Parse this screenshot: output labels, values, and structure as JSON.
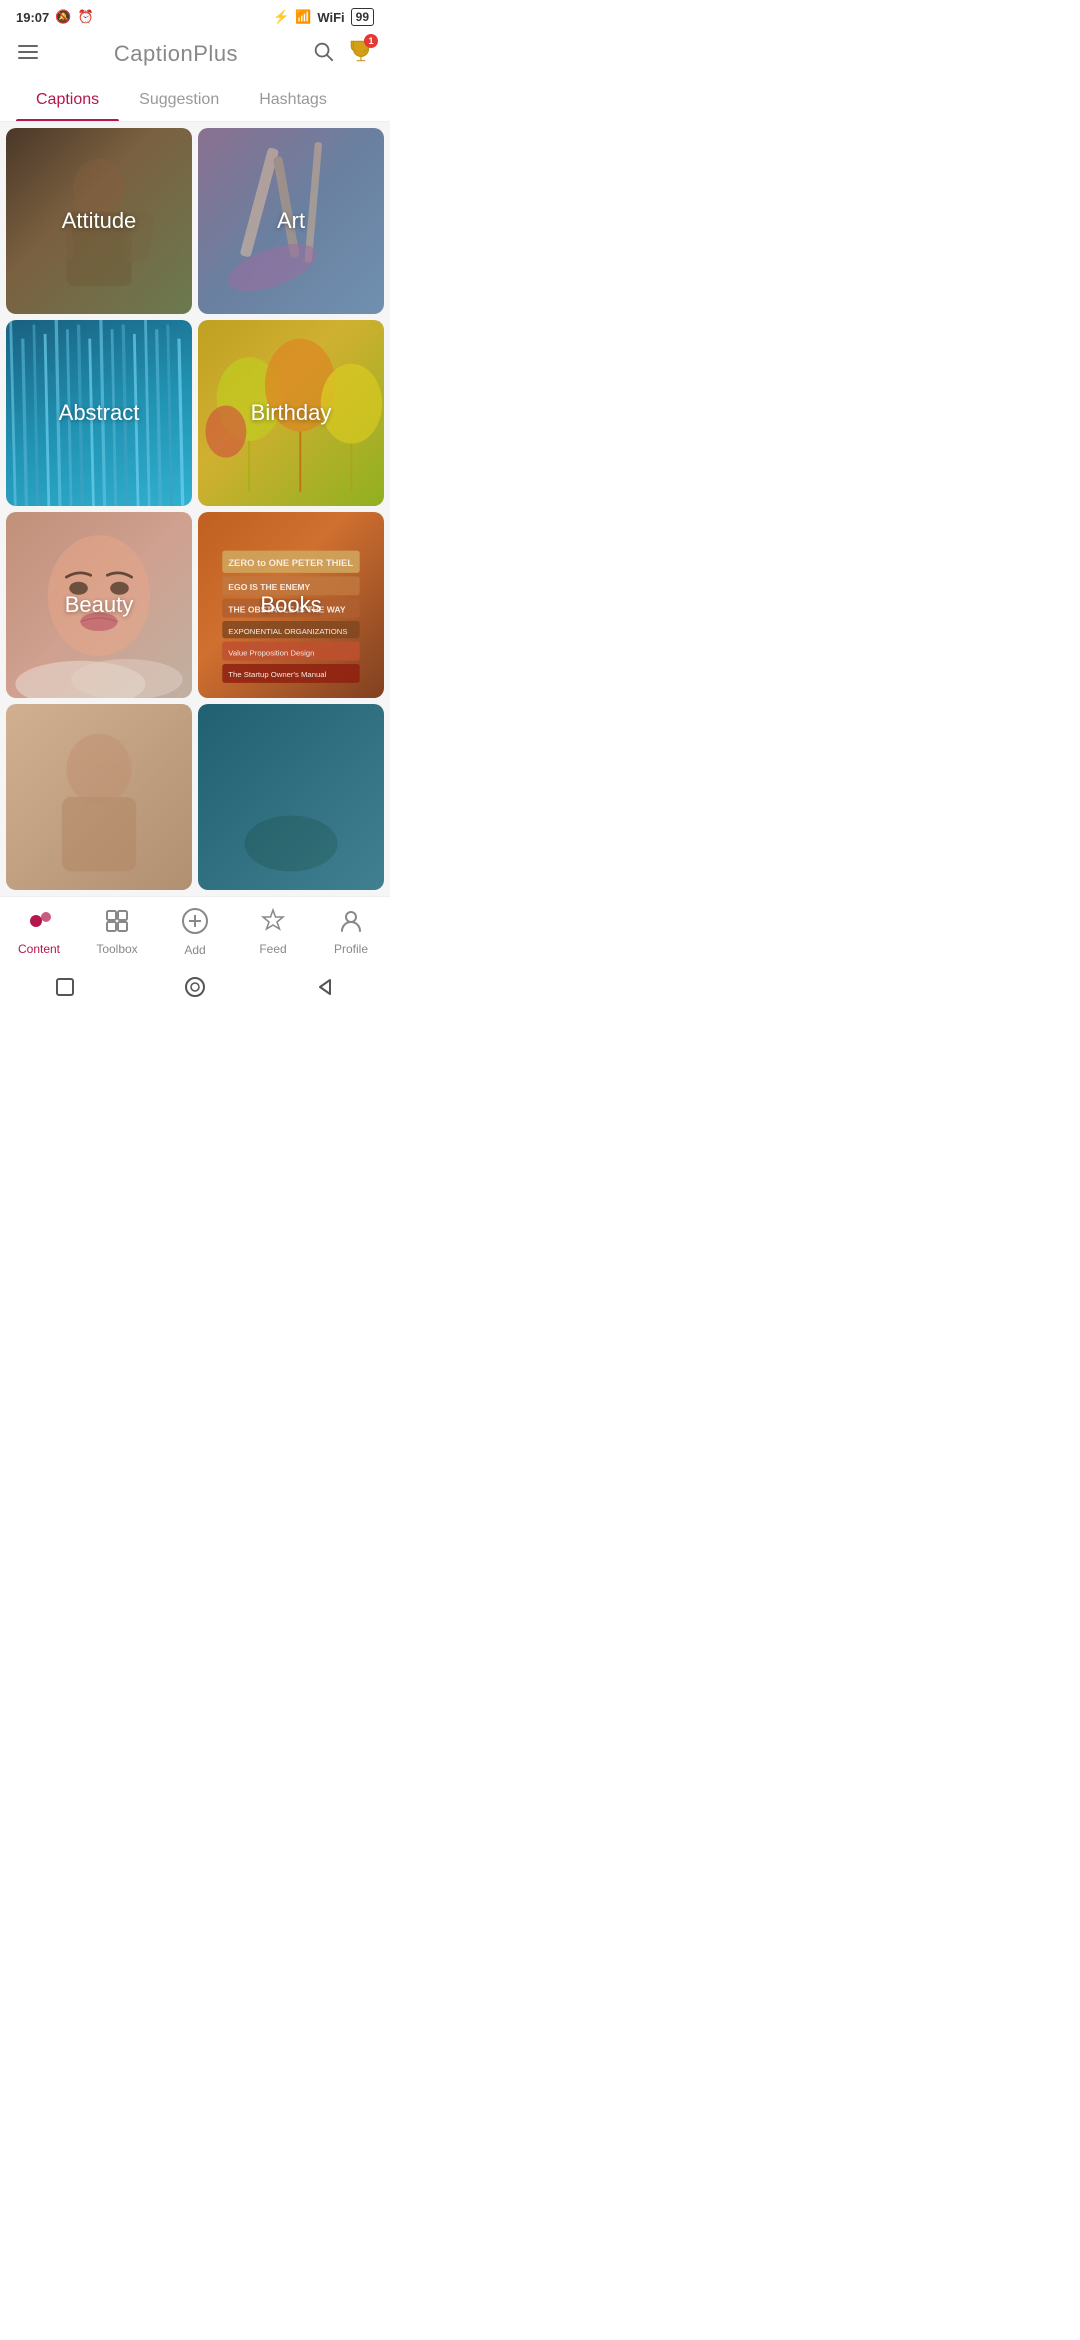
{
  "statusBar": {
    "time": "19:07",
    "battery": "99",
    "batteryIcon": "🔋"
  },
  "header": {
    "title": "CaptionPlus",
    "menuLabel": "menu",
    "searchLabel": "search",
    "trophyBadge": "1"
  },
  "tabs": [
    {
      "id": "captions",
      "label": "Captions",
      "active": true
    },
    {
      "id": "suggestion",
      "label": "Suggestion",
      "active": false
    },
    {
      "id": "hashtags",
      "label": "Hashtags",
      "active": false
    }
  ],
  "gridItems": [
    {
      "id": "attitude",
      "label": "Attitude",
      "class": "item-attitude"
    },
    {
      "id": "art",
      "label": "Art",
      "class": "item-art"
    },
    {
      "id": "abstract",
      "label": "Abstract",
      "class": "item-abstract"
    },
    {
      "id": "birthday",
      "label": "Birthday",
      "class": "item-birthday"
    },
    {
      "id": "beauty",
      "label": "Beauty",
      "class": "item-beauty"
    },
    {
      "id": "books",
      "label": "Books",
      "class": "item-books"
    },
    {
      "id": "bottom-left",
      "label": "",
      "class": "item-bottom-left"
    },
    {
      "id": "bottom-right",
      "label": "",
      "class": "item-bottom-right"
    }
  ],
  "bottomNav": [
    {
      "id": "content",
      "label": "Content",
      "icon": "dots",
      "active": true
    },
    {
      "id": "toolbox",
      "label": "Toolbox",
      "icon": "toolbox",
      "active": false
    },
    {
      "id": "add",
      "label": "Add",
      "icon": "plus",
      "active": false
    },
    {
      "id": "feed",
      "label": "Feed",
      "icon": "star",
      "active": false
    },
    {
      "id": "profile",
      "label": "Profile",
      "icon": "person",
      "active": false
    }
  ],
  "systemNav": {
    "square": "■",
    "circle": "◯",
    "triangle": "◁"
  }
}
